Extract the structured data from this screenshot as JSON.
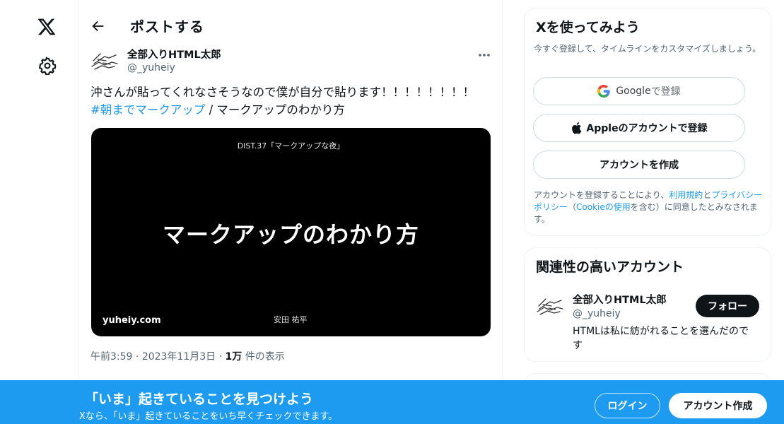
{
  "header": {
    "title": "ポストする"
  },
  "post": {
    "author_name": "全部入りHTML太郎",
    "author_handle": "@_yuheiy",
    "text_line1": "沖さんが貼ってくれなさそうなので僕が自分で貼ります！！！！！！！！",
    "hashtag": "#朝までマークアップ",
    "text_line2_rest": " / マークアップのわかり方",
    "media": {
      "event_label": "DIST.37「マークアップな夜」",
      "slide_title": "マークアップのわかり方",
      "site": "yuheiy.com",
      "presenter": "安田 祐平"
    },
    "meta": {
      "time": "午前3:59",
      "sep1": " · ",
      "date": "2023年11月3日",
      "sep2": " · ",
      "views_count": "1万",
      "views_label": " 件の表示"
    }
  },
  "signup_card": {
    "title": "Xを使ってみよう",
    "subtitle": "今すぐ登録して、タイムラインをカスタマイズしましょう。",
    "google_brand": "Google",
    "google_suffix": " で登録",
    "apple_label": "Appleのアカウントで登録",
    "create_label": "アカウントを作成",
    "terms_prefix": "アカウントを登録することにより、",
    "terms_link": "利用規約",
    "terms_and": "と",
    "privacy_link": "プライバシーポリシー",
    "paren_open": "（",
    "cookie_link": "Cookieの使用",
    "terms_suffix": "を含む）に同意したとみなされます。"
  },
  "related": {
    "title": "関連性の高いアカウント",
    "name": "全部入りHTML太郎",
    "handle": "@_yuheiy",
    "bio": "HTMLは私に紡がれることを選んだのです",
    "follow_label": "フォロー"
  },
  "banner": {
    "title": "「いま」起きていることを見つけよう",
    "subtitle": "Xなら、「いま」起きていることをいち早くチェックできます。",
    "login_label": "ログイン",
    "signup_label": "アカウント作成"
  },
  "colors": {
    "accent": "#1d9bf0",
    "text": "#0f1419",
    "muted": "#536471"
  },
  "icons": {
    "logo": "x-logo-icon",
    "settings": "gear-icon",
    "back": "back-arrow-icon",
    "more": "more-icon",
    "google": "google-g-icon",
    "apple": "apple-icon"
  }
}
